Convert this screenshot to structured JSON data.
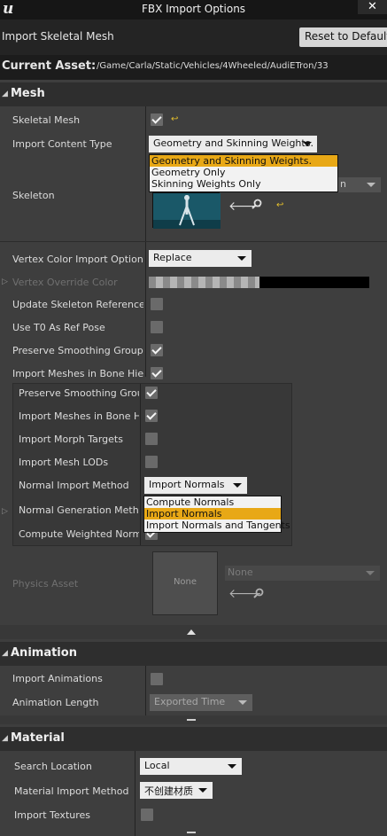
{
  "window": {
    "logo": "u",
    "title": "FBX Import Options",
    "close": "✕"
  },
  "header": {
    "subtitle": "Import Skeletal Mesh",
    "reset_label": "Reset to Default"
  },
  "asset": {
    "label": "Current Asset:",
    "path": "/Game/Carla/Static/Vehicles/4Wheeled/AudiETron/33"
  },
  "mesh": {
    "title": "Mesh",
    "skeletal_mesh_label": "Skeletal Mesh",
    "skeletal_mesh_checked": true,
    "import_content_type_label": "Import Content Type",
    "import_content_type_value": "Geometry and Skinning Weights.",
    "import_content_type_options": [
      "Geometry and Skinning Weights.",
      "Geometry Only",
      "Skinning Weights Only"
    ],
    "skeleton_label": "Skeleton",
    "skeleton_combo_partial": "n",
    "vertex_color_label": "Vertex Color Import Option",
    "vertex_color_value": "Replace",
    "vertex_override_label": "Vertex Override Color",
    "update_skeleton_ref_label": "Update Skeleton Reference Pose",
    "update_skeleton_ref_checked": false,
    "use_t0_label": "Use T0 As Ref Pose",
    "use_t0_checked": false,
    "preserve_smoothing_label": "Preserve Smoothing Groups",
    "preserve_smoothing_checked": true,
    "import_bone_hier_label": "Import Meshes in Bone Hierarchy",
    "import_bone_hier_checked": true,
    "sub": {
      "preserve_smoothing_label": "Preserve Smoothing Groups",
      "preserve_smoothing_checked": true,
      "import_bone_hier_label": "Import Meshes in Bone Hierarchy",
      "import_bone_hier_checked": true,
      "import_morph_label": "Import Morph Targets",
      "import_morph_checked": false,
      "import_lods_label": "Import Mesh LODs",
      "import_lods_checked": false,
      "normal_import_label": "Normal Import Method",
      "normal_import_value": "Import Normals",
      "normal_import_options": [
        "Compute Normals",
        "Import Normals",
        "Import Normals and Tangents"
      ],
      "normal_gen_label": "Normal Generation Method",
      "compute_weighted_label": "Compute Weighted Normals"
    },
    "physics_asset_label": "Physics Asset",
    "physics_thumb_label": "None",
    "physics_combo_value": "None"
  },
  "animation": {
    "title": "Animation",
    "import_animations_label": "Import Animations",
    "import_animations_checked": false,
    "animation_length_label": "Animation Length",
    "animation_length_value": "Exported Time"
  },
  "material": {
    "title": "Material",
    "search_location_label": "Search Location",
    "search_location_value": "Local",
    "material_import_label": "Material Import Method",
    "material_import_value": "不创建材质",
    "import_textures_label": "Import Textures",
    "import_textures_checked": false
  },
  "colors": {
    "accent": "#e8a816",
    "background": "#3e3e3e",
    "category": "#2e2e2e"
  }
}
